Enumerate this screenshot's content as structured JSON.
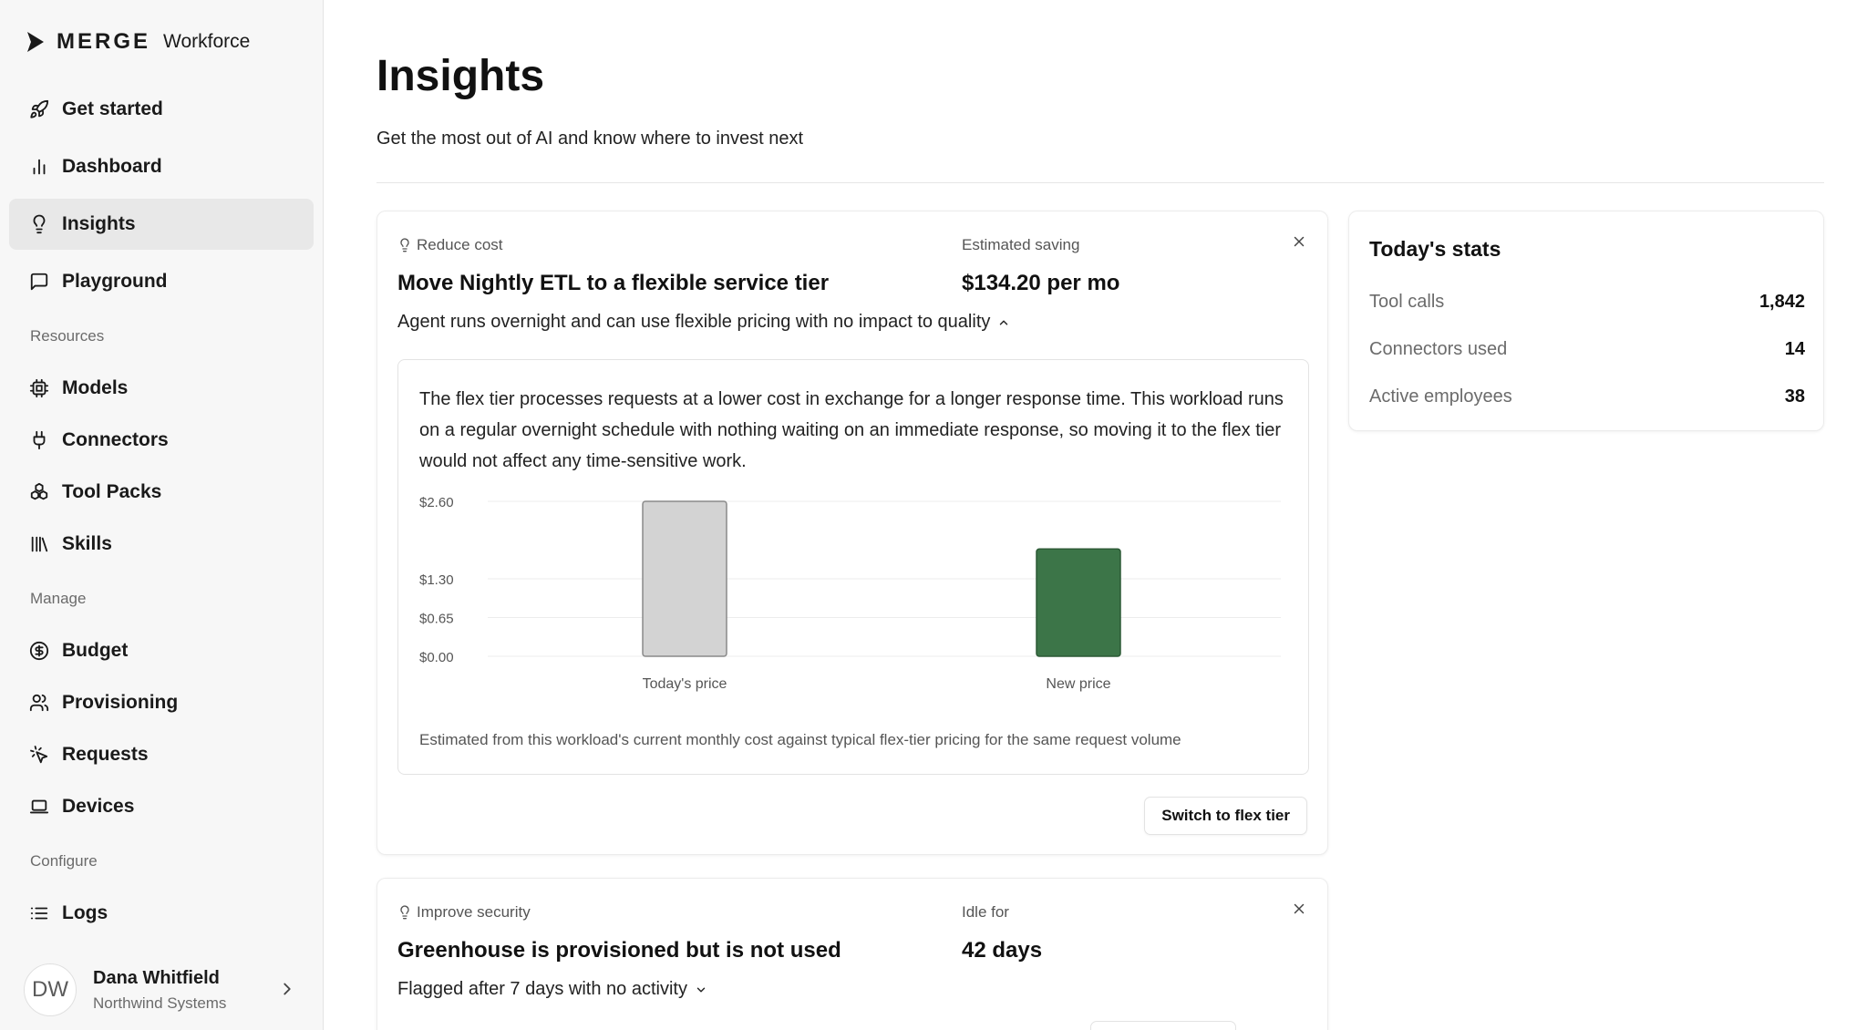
{
  "brand": {
    "name": "MERGE",
    "product": "Workforce"
  },
  "sidebar": {
    "items": [
      {
        "label": "Get started",
        "icon": "rocket-icon"
      },
      {
        "label": "Dashboard",
        "icon": "bar-chart-icon"
      },
      {
        "label": "Insights",
        "icon": "lightbulb-icon",
        "active": true
      },
      {
        "label": "Playground",
        "icon": "message-square-icon"
      }
    ],
    "sections": {
      "resources": {
        "title": "Resources",
        "items": [
          {
            "label": "Models",
            "icon": "cpu-icon"
          },
          {
            "label": "Connectors",
            "icon": "plug-icon"
          },
          {
            "label": "Tool Packs",
            "icon": "cubes-icon"
          },
          {
            "label": "Skills",
            "icon": "library-icon"
          }
        ]
      },
      "manage": {
        "title": "Manage",
        "items": [
          {
            "label": "Budget",
            "icon": "dollar-circle-icon"
          },
          {
            "label": "Provisioning",
            "icon": "users-icon"
          },
          {
            "label": "Requests",
            "icon": "pointer-click-icon"
          },
          {
            "label": "Devices",
            "icon": "laptop-icon"
          }
        ]
      },
      "configure": {
        "title": "Configure",
        "items": [
          {
            "label": "Logs",
            "icon": "list-icon"
          }
        ]
      }
    },
    "user": {
      "initials": "DW",
      "name": "Dana Whitfield",
      "org": "Northwind Systems"
    }
  },
  "header": {
    "title": "Insights",
    "subtitle": "Get the most out of AI and know where to invest next"
  },
  "recommendations": [
    {
      "category": "Reduce cost",
      "title": "Move Nightly ETL to a flexible service tier",
      "description": "Agent runs overnight and can use flexible pricing with no impact to quality",
      "metric_label": "Estimated saving",
      "metric_value": "$134.20 per mo",
      "detail_text": "The flex tier processes requests at a lower cost in exchange for a longer response time. This workload runs on a regular overnight schedule with nothing waiting on an immediate response, so moving it to the flex tier would not affect any time-sensitive work.",
      "chart_note": "Estimated from this workload's current monthly cost against typical flex-tier pricing for the same request volume",
      "action_label": "Switch to flex tier"
    },
    {
      "category": "Improve security",
      "title": "Greenhouse is provisioned but is not used",
      "description": "Flagged after 7 days with no activity",
      "metric_label": "Idle for",
      "metric_value": "42 days"
    }
  ],
  "stats": {
    "title": "Today's stats",
    "rows": [
      {
        "label": "Tool calls",
        "value": "1,842"
      },
      {
        "label": "Connectors used",
        "value": "14"
      },
      {
        "label": "Active employees",
        "value": "38"
      }
    ]
  },
  "colors": {
    "bar_today": "#d3d3d3",
    "bar_new": "#3c7548",
    "sidebar_bg": "#f7f7f7",
    "active_item_bg": "#e8e8e8"
  },
  "chart_data": {
    "type": "bar",
    "categories": [
      "Today's price",
      "New price"
    ],
    "values": [
      2.6,
      1.8
    ],
    "yticks": [
      0,
      0.65,
      1.3,
      2.6
    ],
    "ytick_labels": [
      "$0.00",
      "$0.65",
      "$1.30",
      "$2.60"
    ],
    "ylim": [
      0,
      2.6
    ],
    "grid": true,
    "title": "",
    "xlabel": "",
    "ylabel": ""
  }
}
